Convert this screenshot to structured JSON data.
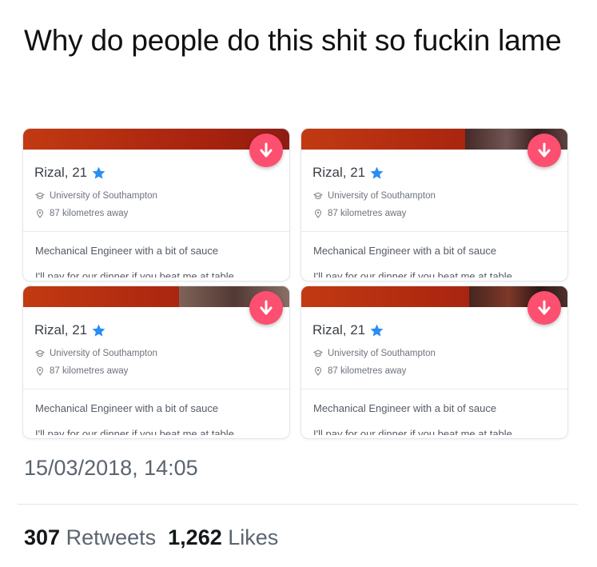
{
  "tweet": {
    "text": "Why do people do this shit so fuckin lame",
    "timestamp": "15/03/2018, 14:05",
    "retweet_count": "307",
    "retweet_label": "Retweets",
    "like_count": "1,262",
    "like_label": "Likes"
  },
  "cards": [
    {
      "name": "Rizal, 21",
      "school": "University of Southampton",
      "distance": "87 kilometres away",
      "bio": "Mechanical Engineer with a bit of sauce",
      "bio_cut": "I'll pay for our dinner if you beat me at table"
    },
    {
      "name": "Rizal, 21",
      "school": "University of Southampton",
      "distance": "87 kilometres away",
      "bio": "Mechanical Engineer with a bit of sauce",
      "bio_cut": "I'll pay for our dinner if you beat me at table"
    },
    {
      "name": "Rizal, 21",
      "school": "University of Southampton",
      "distance": "87 kilometres away",
      "bio": "Mechanical Engineer with a bit of sauce",
      "bio_cut": "I'll pay for our dinner if you beat me at table"
    },
    {
      "name": "Rizal, 21",
      "school": "University of Southampton",
      "distance": "87 kilometres away",
      "bio": "Mechanical Engineer with a bit of sauce",
      "bio_cut": "I'll pay for our dinner if you beat me at table"
    }
  ],
  "icons": {
    "collapse": "arrow-down-icon",
    "verified": "star-icon",
    "school": "graduation-cap-icon",
    "distance": "location-pin-icon"
  },
  "colors": {
    "accent_button": "#fd4f6f",
    "star": "#2a8df4",
    "photo_strip": "#c23a12"
  }
}
